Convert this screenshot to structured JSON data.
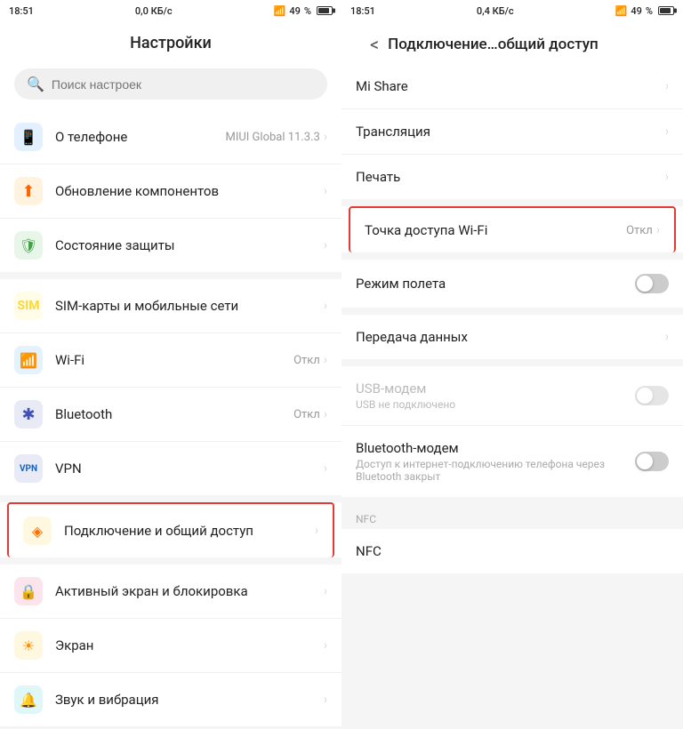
{
  "left": {
    "status": {
      "time": "18:51",
      "network": "0,0 КБ/с",
      "signal": "49"
    },
    "title": "Настройки",
    "search_placeholder": "Поиск настроек",
    "groups": [
      {
        "items": [
          {
            "id": "about",
            "icon": "📱",
            "icon_class": "icon-blue",
            "label": "О телефоне",
            "value": "MIUI Global 11.3.3",
            "has_chevron": true
          },
          {
            "id": "update",
            "icon": "⬆",
            "icon_class": "icon-orange",
            "label": "Обновление компонентов",
            "value": "",
            "has_chevron": true
          },
          {
            "id": "protection",
            "icon": "🛡",
            "icon_class": "icon-green",
            "label": "Состояние защиты",
            "value": "",
            "has_chevron": true
          }
        ]
      },
      {
        "items": [
          {
            "id": "sim",
            "icon": "📋",
            "icon_class": "icon-yellow",
            "label": "SIM-карты и мобильные сети",
            "value": "",
            "has_chevron": true
          },
          {
            "id": "wifi",
            "icon": "📶",
            "icon_class": "icon-wifi",
            "label": "Wi-Fi",
            "value": "Откл",
            "has_chevron": true
          },
          {
            "id": "bluetooth",
            "icon": "✱",
            "icon_class": "icon-bt",
            "label": "Bluetooth",
            "value": "Откл",
            "has_chevron": true
          },
          {
            "id": "vpn",
            "icon": "VPN",
            "icon_class": "icon-vpn",
            "label": "VPN",
            "value": "",
            "has_chevron": true
          }
        ]
      },
      {
        "highlighted": true,
        "items": [
          {
            "id": "connection",
            "icon": "◈",
            "icon_class": "icon-connect",
            "label": "Подключение и общий доступ",
            "value": "",
            "has_chevron": true
          }
        ]
      },
      {
        "items": [
          {
            "id": "lock",
            "icon": "🔒",
            "icon_class": "icon-lock",
            "label": "Активный экран и блокировка",
            "value": "",
            "has_chevron": true
          },
          {
            "id": "display",
            "icon": "☀",
            "icon_class": "icon-screen",
            "label": "Экран",
            "value": "",
            "has_chevron": true
          },
          {
            "id": "sound",
            "icon": "🔔",
            "icon_class": "icon-sound",
            "label": "Звук и вибрация",
            "value": "",
            "has_chevron": true
          }
        ]
      }
    ]
  },
  "right": {
    "status": {
      "time": "18:51",
      "network": "0,4 КБ/с",
      "signal": "49"
    },
    "back_label": "<",
    "title": "Подключение…общий доступ",
    "groups": [
      {
        "items": [
          {
            "id": "mi-share",
            "label": "Mi Share",
            "has_chevron": true,
            "has_toggle": false
          },
          {
            "id": "broadcast",
            "label": "Трансляция",
            "has_chevron": true,
            "has_toggle": false
          },
          {
            "id": "print",
            "label": "Печать",
            "has_chevron": true,
            "has_toggle": false
          }
        ]
      },
      {
        "highlighted": true,
        "items": [
          {
            "id": "hotspot",
            "label": "Точка доступа Wi-Fi",
            "value": "Откл",
            "has_chevron": true,
            "has_toggle": false
          }
        ]
      },
      {
        "items": [
          {
            "id": "airplane",
            "label": "Режим полета",
            "has_toggle": true,
            "toggle_on": false
          }
        ]
      },
      {
        "items": [
          {
            "id": "data-transfer",
            "label": "Передача данных",
            "has_chevron": true,
            "has_toggle": false
          }
        ]
      },
      {
        "items": [
          {
            "id": "usb-modem",
            "label": "USB-модем",
            "sublabel": "USB не подключено",
            "has_toggle": true,
            "toggle_on": false,
            "disabled": true
          },
          {
            "id": "bt-modem",
            "label": "Bluetooth-модем",
            "sublabel": "Доступ к интернет-подключению телефона через Bluetooth закрыт",
            "has_toggle": true,
            "toggle_on": false
          }
        ]
      },
      {
        "section_label": "NFC",
        "items": [
          {
            "id": "nfc",
            "label": "NFC",
            "has_chevron": false,
            "has_toggle": false
          }
        ]
      }
    ]
  }
}
